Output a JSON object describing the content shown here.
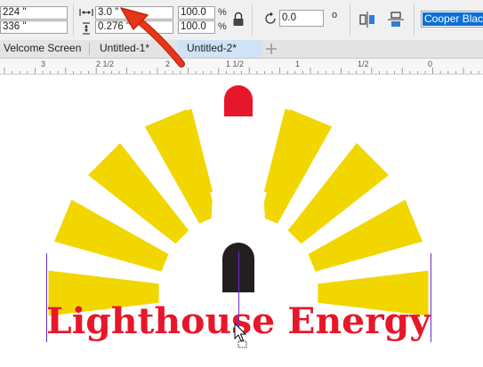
{
  "propbar": {
    "pos_x": "224 \"",
    "pos_y": "336 \"",
    "width": "3.0 \"",
    "height": "0.276 \"",
    "scale_x": "100.0",
    "scale_y": "100.0",
    "percent": "%",
    "rotation": "0.0",
    "degree": "o",
    "font": "Cooper Black"
  },
  "tabs": [
    {
      "label": "Velcome Screen"
    },
    {
      "label": "Untitled-1*"
    },
    {
      "label": "Untitled-2*"
    }
  ],
  "ruler": {
    "labels": [
      "3",
      "2 1/2",
      "2",
      "1 1/2",
      "1",
      "1/2",
      "0"
    ]
  },
  "canvas": {
    "logo_text": "Lighthouse Energy"
  },
  "colors": {
    "sun_yellow": "#f2d600",
    "beacon_red": "#e8162a",
    "door_black": "#231f20",
    "text_red": "#e8162a",
    "guide_purple": "#6a2cd0",
    "arrow_red": "#d42a12",
    "font_field_highlight": "#0a6fd8"
  }
}
